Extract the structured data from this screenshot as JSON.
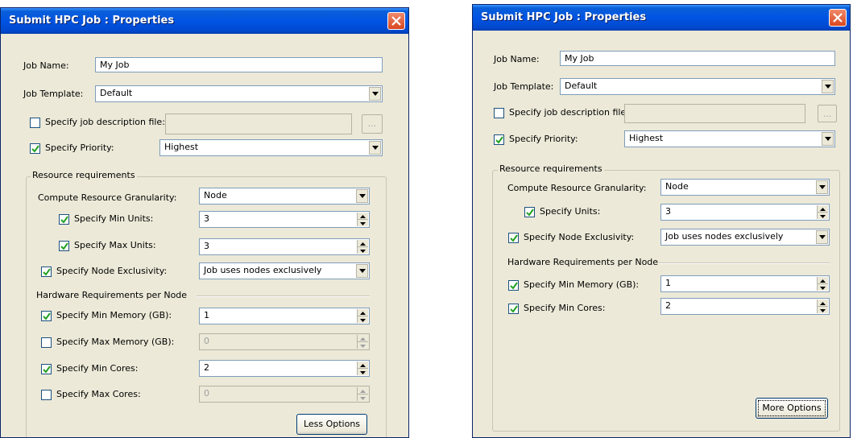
{
  "dialog_left": {
    "title": "Submit HPC Job : Properties",
    "job_name_label": "Job Name:",
    "job_name_value": "My Job",
    "job_template_label": "Job Template:",
    "job_template_value": "Default",
    "desc_file_label": "Specify job description file:",
    "desc_file_checked": false,
    "desc_file_value": "",
    "browse_label": "...",
    "priority_label": "Specify Priority:",
    "priority_checked": true,
    "priority_value": "Highest",
    "resource_group_label": "Resource requirements",
    "granularity_label": "Compute Resource Granularity:",
    "granularity_value": "Node",
    "min_units_label": "Specify Min Units:",
    "min_units_checked": true,
    "min_units_value": "3",
    "max_units_label": "Specify Max Units:",
    "max_units_checked": true,
    "max_units_value": "3",
    "node_excl_label": "Specify Node Exclusivity:",
    "node_excl_checked": true,
    "node_excl_value": "Job uses nodes exclusively",
    "hardware_label": "Hardware Requirements  per Node",
    "min_memory_label": "Specify Min Memory (GB):",
    "min_memory_checked": true,
    "min_memory_value": "1",
    "max_memory_label": "Specify Max Memory (GB):",
    "max_memory_checked": false,
    "max_memory_value": "0",
    "min_cores_label": "Specify Min Cores:",
    "min_cores_checked": true,
    "min_cores_value": "2",
    "max_cores_label": "Specify Max Cores:",
    "max_cores_checked": false,
    "max_cores_value": "0",
    "options_button": "Less Options"
  },
  "dialog_right": {
    "title": "Submit HPC Job : Properties",
    "job_name_label": "Job Name:",
    "job_name_value": "My Job",
    "job_template_label": "Job Template:",
    "job_template_value": "Default",
    "desc_file_label": "Specify job description file:",
    "desc_file_checked": false,
    "desc_file_value": "",
    "browse_label": "...",
    "priority_label": "Specify Priority:",
    "priority_checked": true,
    "priority_value": "Highest",
    "resource_group_label": "Resource requirements",
    "granularity_label": "Compute Resource Granularity:",
    "granularity_value": "Node",
    "units_label": "Specify Units:",
    "units_checked": true,
    "units_value": "3",
    "node_excl_label": "Specify Node Exclusivity:",
    "node_excl_checked": true,
    "node_excl_value": "Job uses nodes exclusively",
    "hardware_label": "Hardware Requirements  per Node",
    "min_memory_label": "Specify Min Memory (GB):",
    "min_memory_checked": true,
    "min_memory_value": "1",
    "min_cores_label": "Specify Min Cores:",
    "min_cores_checked": true,
    "min_cores_value": "2",
    "options_button": "More Options"
  },
  "colors": {
    "title_bar": "#0054e3",
    "dialog_bg": "#ece9d8",
    "close_button": "#d9461f",
    "field_border": "#7f9db9"
  },
  "icons": {
    "close": "close-x-icon",
    "dropdown": "chevron-down-icon",
    "spinner": "spinner-arrows-icon",
    "check": "checkmark-icon"
  }
}
